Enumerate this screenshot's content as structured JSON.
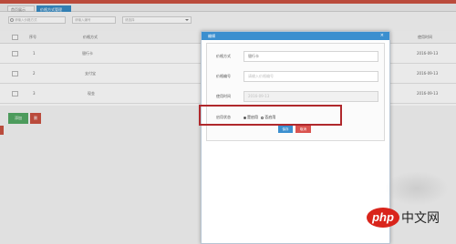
{
  "tabs": [
    {
      "label": "首页展示"
    },
    {
      "label": "价格方式管理"
    }
  ],
  "filters": {
    "field1_placeholder": "请输入价格方式",
    "field2_placeholder": "请输入编号",
    "field3_value": "请选择"
  },
  "grid": {
    "headers": {
      "num": "序号",
      "name": "价格方式",
      "date": "使用时间"
    },
    "rows": [
      {
        "num": "1",
        "name": "银行卡",
        "date": "2016-09-13"
      },
      {
        "num": "2",
        "name": "支付宝",
        "date": "2016-09-13"
      },
      {
        "num": "3",
        "name": "现金",
        "date": "2016-09-13"
      }
    ]
  },
  "actions": {
    "add_label": "添加",
    "delete_label": "删"
  },
  "dialog": {
    "title": "编辑",
    "close_glyph": "×",
    "fields": [
      {
        "label": "价格方式",
        "value": "银行卡"
      },
      {
        "label": "价格编号",
        "placeholder": "请输入价格编号"
      },
      {
        "label": "使用时间",
        "value": "2016-09-13"
      }
    ],
    "status": {
      "label": "启用状态",
      "options": [
        "是启用",
        "否启用"
      ],
      "selected": 0
    },
    "save_label": "保存",
    "close_label": "取消"
  },
  "watermark": {
    "logo": "php",
    "text": "中文网"
  },
  "colors": {
    "accent": "#3b8fcf",
    "danger": "#c94a3a",
    "success": "#4ca65e",
    "highlight": "#b0282c"
  }
}
